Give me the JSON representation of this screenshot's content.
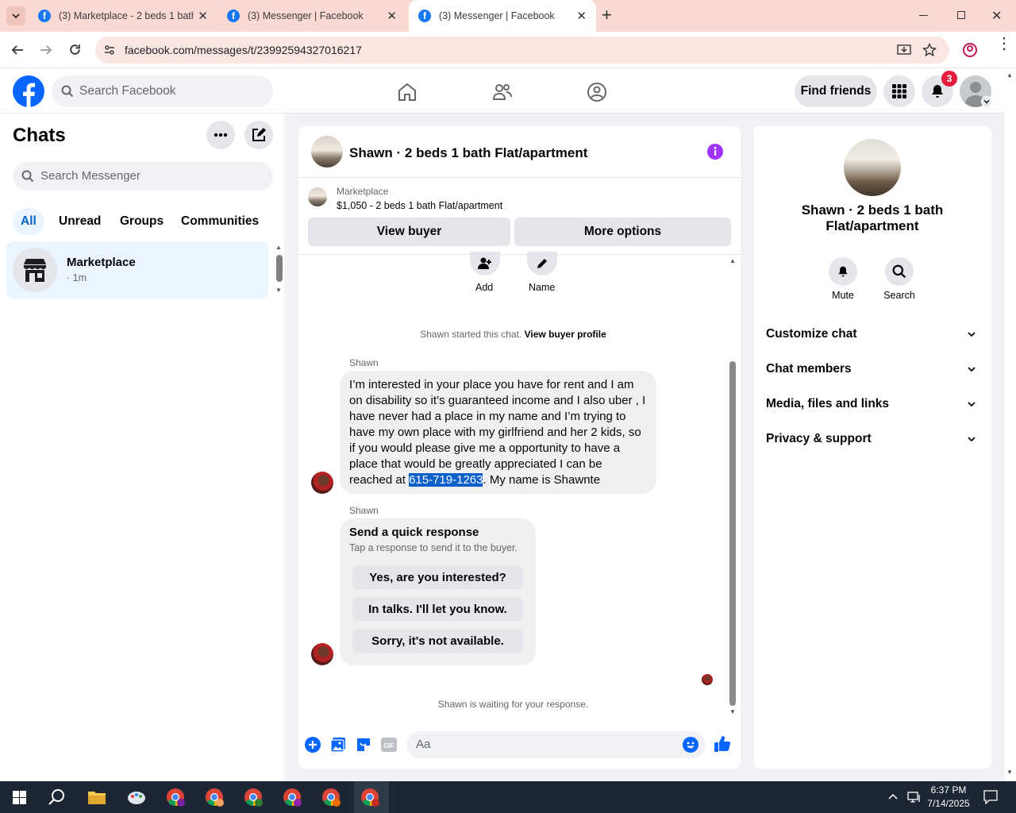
{
  "browser": {
    "tabs": [
      {
        "title": "(3) Marketplace - 2 beds 1 bath",
        "active": false
      },
      {
        "title": "(3) Messenger | Facebook",
        "active": false
      },
      {
        "title": "(3) Messenger | Facebook",
        "active": true
      }
    ],
    "url": "facebook.com/messages/t/23992594327016217"
  },
  "fb_header": {
    "search_placeholder": "Search Facebook",
    "find_friends": "Find friends",
    "notification_count": "3"
  },
  "left": {
    "title": "Chats",
    "search_placeholder": "Search Messenger",
    "filters": [
      "All",
      "Unread",
      "Groups",
      "Communities"
    ],
    "chat_item": {
      "name": "Marketplace",
      "time": "· 1m"
    }
  },
  "chat": {
    "title": "Shawn · 2 beds 1 bath Flat/apartment",
    "listing_label": "Marketplace",
    "listing_title": "$1,050 - 2 beds 1 bath Flat/apartment",
    "view_buyer": "View buyer",
    "more_options": "More options",
    "add_label": "Add",
    "name_label": "Name",
    "started_text": "Shawn started this chat. ",
    "view_profile": "View buyer profile",
    "sender": "Shawn",
    "message_before": "I’m interested in your place you have for rent and I am on disability so it’s guaranteed income and I also uber  , I have never had a place in my name and I’m trying to have my own place with my girlfriend and her 2 kids, so if you would please give me a opportunity to have a place that would be greatly appreciated I can be reached at ",
    "message_phone": "615-719-1263",
    "message_after": ". My name is Shawnte",
    "quick_title": "Send a quick response",
    "quick_subtitle": "Tap a response to send it to the buyer.",
    "quick_responses": [
      "Yes, are you interested?",
      "In talks. I'll let you know.",
      "Sorry, it's not available."
    ],
    "waiting": "Shawn is waiting for your response.",
    "composer_placeholder": "Aa"
  },
  "info": {
    "title": "Shawn · 2 beds 1 bath Flat/apartment",
    "mute": "Mute",
    "search": "Search",
    "sections": [
      "Customize chat",
      "Chat members",
      "Media, files and links",
      "Privacy & support"
    ]
  },
  "taskbar": {
    "time": "6:37 PM",
    "date": "7/14/2025"
  },
  "colors": {
    "fb_blue": "#0866ff",
    "tab_bg": "#f9d9d2",
    "info_purple": "#a033ff",
    "selection": "#0a5fc9"
  }
}
